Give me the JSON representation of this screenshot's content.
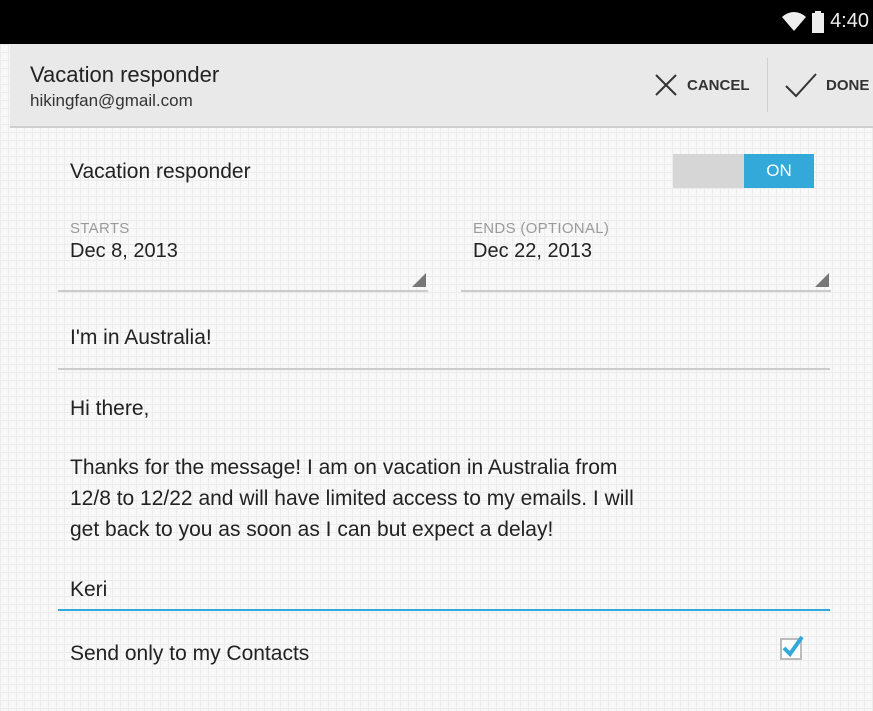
{
  "status_bar": {
    "time": "4:40"
  },
  "action_bar": {
    "title": "Vacation responder",
    "account": "hikingfan@gmail.com",
    "cancel_label": "CANCEL",
    "done_label": "DONE"
  },
  "responder": {
    "label": "Vacation responder",
    "toggle_state": "ON",
    "accent_color": "#33a9d9"
  },
  "dates": {
    "starts_label": "STARTS",
    "starts_value": "Dec 8, 2013",
    "ends_label": "ENDS (OPTIONAL)",
    "ends_value": "Dec 22, 2013"
  },
  "subject": "I'm in Australia!",
  "message": {
    "greeting": "Hi there,",
    "line1": "Thanks for the message! I am on vacation in Australia from",
    "line2": "12/8 to 12/22 and will have limited access to my emails. I will",
    "line3": "get back to you as soon as I can but expect a delay!",
    "signature": "Keri"
  },
  "contacts_only": {
    "label": "Send only to my Contacts",
    "checked": true
  }
}
